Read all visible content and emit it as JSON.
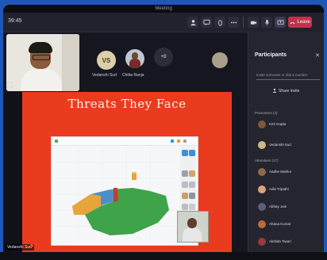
{
  "window": {
    "title": "Meeting"
  },
  "toolbar": {
    "time": "39:45",
    "leave_label": "Leave"
  },
  "tiles": {
    "avatar_initials": "VS",
    "avatar_name": "Vedanshi Sud",
    "photo_name": "Chitta Ranja",
    "more_label": "+8"
  },
  "share": {
    "slide_title": "Threats They Face",
    "presenter": "Vedanshi Sud"
  },
  "panel": {
    "title": "Participants",
    "search_placeholder": "Invite someone or dial a number",
    "share_invite": "Share invite",
    "presenters_label": "Presenters (2)",
    "attendees_label": "Attendees (17)",
    "presenters": [
      {
        "name": "Kirti Gupta",
        "color": "#7a5a3a"
      },
      {
        "name": "Vedanshi Sud",
        "color": "#c9b98a"
      }
    ],
    "attendees": [
      {
        "name": "Aadhe Mathur",
        "color": "#8a6a4a"
      },
      {
        "name": "Aditi Tripathi",
        "color": "#d9a37a"
      },
      {
        "name": "Abhay Jain",
        "color": "#5e5e7a"
      },
      {
        "name": "Ahana Kumar",
        "color": "#b76a3a"
      },
      {
        "name": "Akshita Tiwari",
        "color": "#9a3a3a"
      }
    ]
  },
  "colors": {
    "slide_bg": "#ea3b1e",
    "leave": "#c4314b",
    "accent": "#5b5bd6",
    "frame_bg": "#1f57b8"
  }
}
